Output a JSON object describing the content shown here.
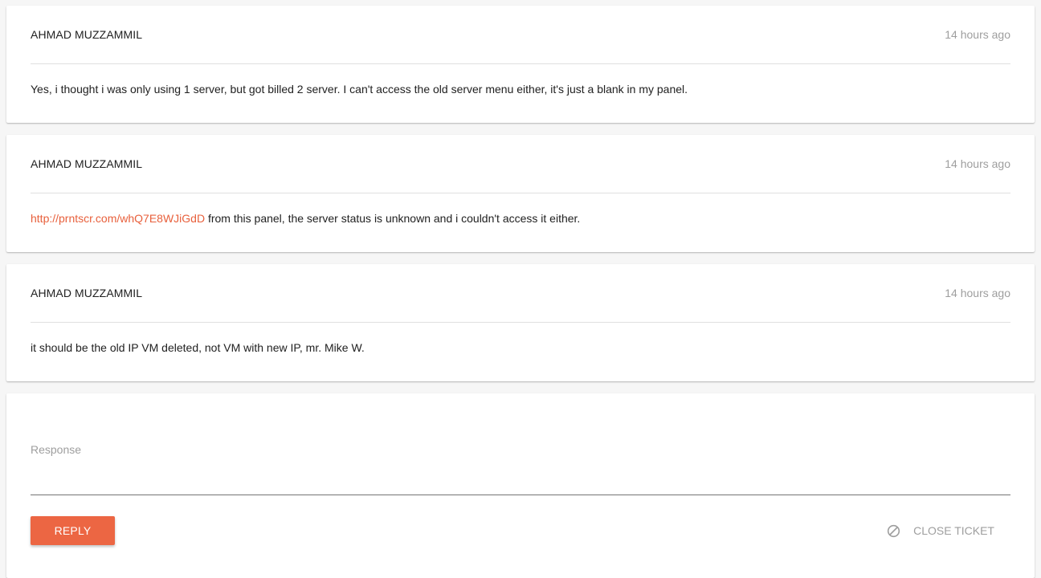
{
  "messages": [
    {
      "author": "AHMAD MUZZAMMIL",
      "time": "14 hours ago",
      "link": "",
      "text": "Yes, i thought i was only using 1 server, but got billed 2 server. I can't access the old server menu either, it's just a blank in my panel."
    },
    {
      "author": "AHMAD MUZZAMMIL",
      "time": "14 hours ago",
      "link": "http://prntscr.com/whQ7E8WJiGdD",
      "text": " from this panel, the server status is unknown and i couldn't access it either."
    },
    {
      "author": "AHMAD MUZZAMMIL",
      "time": "14 hours ago",
      "link": "",
      "text": "it should be the old IP VM deleted, not VM with new IP, mr. Mike W."
    }
  ],
  "reply": {
    "placeholder": "Response",
    "value": "",
    "reply_label": "REPLY",
    "close_label": "CLOSE TICKET",
    "close_icon": "block-icon"
  },
  "colors": {
    "accent": "#ec6643",
    "link": "#e8603c",
    "muted": "#9e9e9e"
  }
}
